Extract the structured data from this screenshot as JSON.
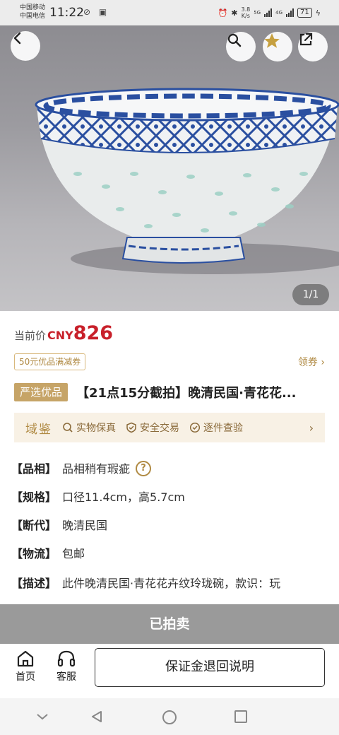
{
  "status_bar": {
    "carrier1": "中国移动",
    "carrier2": "中国电信",
    "time": "11:22",
    "net_speed_value": "3.8",
    "net_speed_unit": "K/s",
    "net_type1": "5G",
    "net_type2": "4G",
    "battery": "71"
  },
  "hero": {
    "image_counter": "1/1"
  },
  "price": {
    "label": "当前价",
    "currency": "CNY",
    "value": "826"
  },
  "coupon": {
    "label": "50元优品满减券",
    "get": "领券 ›"
  },
  "product": {
    "tag": "严选优品",
    "title": "【21点15分截拍】晚清民国·青花花..."
  },
  "guarantee": {
    "brand": "域鉴",
    "items": [
      "实物保真",
      "安全交易",
      "逐件查验"
    ]
  },
  "attributes": [
    {
      "key": "【品相】",
      "value": "品相稍有瑕疵"
    },
    {
      "key": "【规格】",
      "value": "口径11.4cm，高5.7cm"
    },
    {
      "key": "【断代】",
      "value": "晚清民国"
    },
    {
      "key": "【物流】",
      "value": "包邮"
    }
  ],
  "description": {
    "key": "【描述】",
    "value": "此件晚清民国·青花花卉纹玲珑碗，款识：玩"
  },
  "sold_bar": {
    "label": "已拍卖"
  },
  "bottom_bar": {
    "home": "首页",
    "service": "客服",
    "deposit": "保证金退回说明"
  },
  "colors": {
    "price_red": "#c8202a",
    "gold": "#b08a43",
    "sold_gray": "#9a9a9a"
  }
}
